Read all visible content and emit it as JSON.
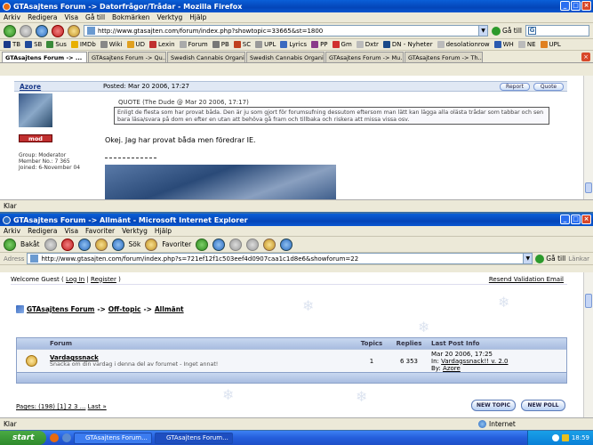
{
  "firefox": {
    "title": "GTAsajtens Forum -> Datorfrågor/Trådar - Mozilla Firefox",
    "menu": [
      "Arkiv",
      "Redigera",
      "Visa",
      "Gå till",
      "Bokmärken",
      "Verktyg",
      "Hjälp"
    ],
    "url": "http://www.gtasajten.com/forum/index.php?showtopic=33665&st=1800",
    "go_label": "Gå till",
    "bookmarks": [
      "TB",
      "SB",
      "Sus",
      "IMDb",
      "Wiki",
      "UD",
      "Lexin",
      "Forum",
      "PB",
      "SC",
      "UPL",
      "Lyrics",
      "PP",
      "Gm",
      "Dxtr",
      "DN - Nyheter",
      "desolationrow",
      "WH",
      "NE",
      "UPL"
    ],
    "tabs": [
      "GTAsajtens Forum -> ...",
      "GTAsajtens Forum -> Qu...",
      "Swedish Cannabis Organi...",
      "Swedish Cannabis Organi...",
      "GTAsajtens Forum -> Mu...",
      "GTAsajtens Forum -> Th..."
    ],
    "active_tab": 0,
    "post": {
      "author": "Azore",
      "posted": "Posted: Mar 20 2006, 17:27",
      "report_label": "Report",
      "quote_label": "Quote",
      "badge": "mod",
      "member_info": [
        "Group: Moderator",
        "Member No.: 7 365",
        "Joined: 6-November 04"
      ],
      "quote_header": "QUOTE (The Dude @ Mar 20 2006, 17:17)",
      "quote_text": "Enligt de flesta som har provat båda. Den är ju som gjort för forumsufning dessutom eftersom man lätt kan lägga alla olästa trådar som tabbar och sen bara läsa/svara på dom en efter en utan att behöva gå fram och tillbaka och riskera att missa vissa osv.",
      "body": "Okej. Jag har provat båda men föredrar IE."
    },
    "status": "Klar"
  },
  "ie": {
    "title": "GTAsajtens Forum -> Allmänt - Microsoft Internet Explorer",
    "menu": [
      "Arkiv",
      "Redigera",
      "Visa",
      "Favoriter",
      "Verktyg",
      "Hjälp"
    ],
    "back_label": "Bakåt",
    "search_label": "Sök",
    "favorites_label": "Favoriter",
    "address_label": "Adress",
    "url": "http://www.gtasajten.com/forum/index.php?s=721ef12f1c503eef4d0907caa1c1d8e6&showforum=22",
    "go_label": "Gå till",
    "links_label": "Länkar",
    "welcome_prefix": "Welcome Guest ( ",
    "login_label": "Log In",
    "register_label": "Register",
    "resend_label": "Resend Validation Email",
    "breadcrumb": [
      "GTAsajtens Forum",
      "Off-topic",
      "Allmänt"
    ],
    "table_headers": {
      "forum": "Forum",
      "topics": "Topics",
      "replies": "Replies",
      "last_post": "Last Post Info"
    },
    "forum_row": {
      "name": "Vardagssnack",
      "description": "Snacka om din vardag i denna del av forumet - Inget annat!",
      "topics": "1",
      "replies": "6 353",
      "last_date": "Mar 20 2006, 17:25",
      "last_in_prefix": "In: ",
      "last_in": "Vardagssnack!! v. 2.0",
      "last_by_prefix": "By: ",
      "last_by": "Azore"
    },
    "pages_text": "Pages: (198) [1] 2 3 ...",
    "last_label": "Last »",
    "new_topic_label": "NEW TOPIC",
    "new_poll_label": "NEW POLL",
    "status": "Klar",
    "zone": "Internet"
  },
  "taskbar": {
    "start_label": "start",
    "tasks": [
      "GTAsajtens Forum...",
      "GTAsajtens Forum..."
    ],
    "clock": "18:59"
  }
}
